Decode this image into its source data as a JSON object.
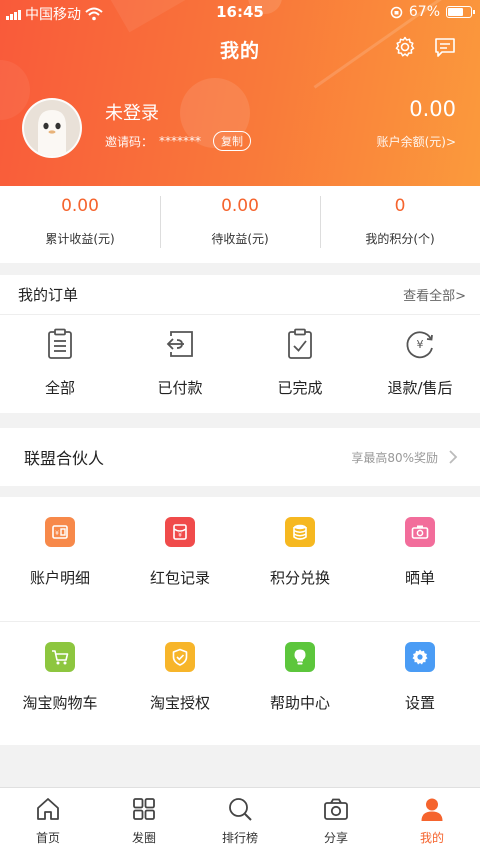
{
  "status_bar": {
    "carrier": "中国移动",
    "time": "16:45",
    "battery_percent": "67%",
    "battery_level": 0.67
  },
  "header": {
    "title": "我的",
    "settings_icon": "gear-icon",
    "message_icon": "message-icon"
  },
  "profile": {
    "username": "未登录",
    "invite_label": "邀请码：",
    "invite_code": "*******",
    "copy_label": "复制",
    "balance": "0.00",
    "balance_label": "账户余额(元)>"
  },
  "stats": [
    {
      "value": "0.00",
      "label": "累计收益(元)"
    },
    {
      "value": "0.00",
      "label": "待收益(元)"
    },
    {
      "value": "0",
      "label": "我的积分(个)"
    }
  ],
  "orders": {
    "title": "我的订单",
    "view_all": "查看全部>",
    "items": [
      {
        "label": "全部",
        "icon": "clipboard-icon"
      },
      {
        "label": "已付款",
        "icon": "paid-icon"
      },
      {
        "label": "已完成",
        "icon": "clipboard-check-icon"
      },
      {
        "label": "退款/售后",
        "icon": "refund-icon"
      }
    ]
  },
  "partner": {
    "title": "联盟合伙人",
    "reward": "享最高80%奖励"
  },
  "features": [
    {
      "label": "账户明细",
      "icon": "wallet-icon",
      "color": "#f7894a"
    },
    {
      "label": "红包记录",
      "icon": "red-envelope-icon",
      "color": "#f04b4b"
    },
    {
      "label": "积分兑换",
      "icon": "coins-icon",
      "color": "#f6b820"
    },
    {
      "label": "晒单",
      "icon": "camera-icon",
      "color": "#f26d9b"
    },
    {
      "label": "淘宝购物车",
      "icon": "cart-icon",
      "color": "#8dc63f"
    },
    {
      "label": "淘宝授权",
      "icon": "shield-icon",
      "color": "#f7b52a"
    },
    {
      "label": "帮助中心",
      "icon": "lightbulb-icon",
      "color": "#5cc63c"
    },
    {
      "label": "设置",
      "icon": "settings-icon",
      "color": "#4a9cf5"
    }
  ],
  "tabbar": [
    {
      "label": "首页",
      "icon": "home-icon"
    },
    {
      "label": "发圈",
      "icon": "grid-icon"
    },
    {
      "label": "排行榜",
      "icon": "search-icon"
    },
    {
      "label": "分享",
      "icon": "camera-icon"
    },
    {
      "label": "我的",
      "icon": "user-icon",
      "active": true
    }
  ],
  "colors": {
    "accent": "#f5642e",
    "header_start": "#f95a3a",
    "header_end": "#fb9a3c"
  }
}
